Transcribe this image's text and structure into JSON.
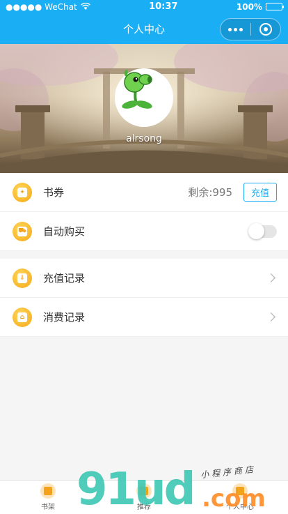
{
  "status_bar": {
    "carrier": "●●●●● WeChat",
    "time": "10:37",
    "battery": "100%"
  },
  "navbar": {
    "title": "个人中心"
  },
  "profile": {
    "username": "alrsong"
  },
  "list": {
    "voucher_label": "书券",
    "voucher_remaining": "剩余:995",
    "recharge_button": "充值",
    "auto_buy_label": "自动购买",
    "auto_buy_on": false,
    "recharge_records_label": "充值记录",
    "consume_records_label": "消费记录"
  },
  "tabbar": {
    "items": [
      {
        "label": "书架"
      },
      {
        "label": "推荐"
      },
      {
        "label": "个人中心"
      }
    ]
  },
  "watermark": {
    "main": "91ud",
    "domain": ".com",
    "tagline": "小程序商店"
  },
  "colors": {
    "primary": "#1aaef5",
    "icon_gold": "#f4a718"
  }
}
